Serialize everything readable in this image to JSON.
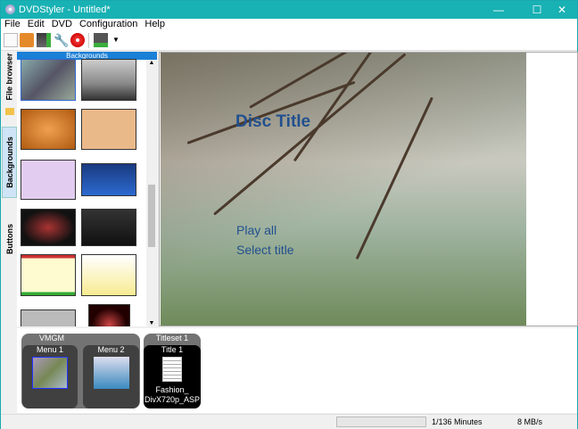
{
  "window": {
    "title": "DVDStyler - Untitled*",
    "controls": [
      "minimize",
      "maximize",
      "close"
    ]
  },
  "menu": [
    "File",
    "Edit",
    "DVD",
    "Configuration",
    "Help"
  ],
  "toolbar": [
    "new-icon",
    "open-icon",
    "save-icon",
    "settings-icon",
    "burn-icon",
    "add-file-icon"
  ],
  "side_tabs": [
    "File browser",
    "Backgrounds",
    "Buttons"
  ],
  "backgrounds_header": "Backgrounds",
  "menu_preview": {
    "title": "Disc Title",
    "buttons": [
      "Play all",
      "Select title"
    ]
  },
  "titleset_manager": {
    "vmgm": {
      "label": "VMGM",
      "menus": [
        "Menu 1",
        "Menu 2"
      ]
    },
    "titleset": {
      "label": "Titleset 1",
      "title": "Title 1",
      "file": "Fashion_\nDivX720p_ASP"
    }
  },
  "status": {
    "duration": "1/136 Minutes",
    "bitrate": "8 MB/s"
  },
  "colors": {
    "titlebar": "#18b1b4",
    "accent": "#1a7fd6",
    "menu_text": "#22508e"
  }
}
